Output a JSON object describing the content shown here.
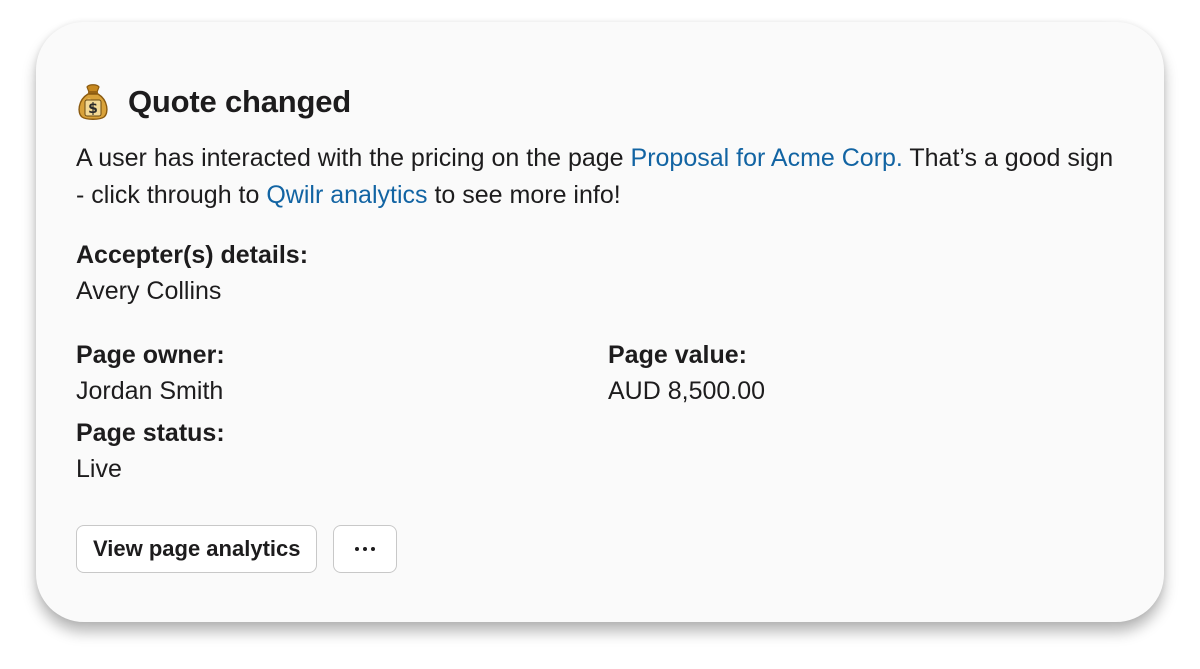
{
  "notification": {
    "icon": "money-bag-icon",
    "title": "Quote changed",
    "message": {
      "text_before": "A user has interacted with the pricing on the page ",
      "page_link": "Proposal for Acme Corp.",
      "text_middle": " That’s a good sign - click through to ",
      "analytics_link": "Qwilr analytics",
      "text_after": " to see more info!"
    },
    "accepter": {
      "label": "Accepter(s) details:",
      "value": "Avery Collins"
    },
    "page_owner": {
      "label": "Page owner:",
      "value": "Jordan Smith"
    },
    "page_value": {
      "label": "Page value:",
      "value": "AUD 8,500.00"
    },
    "page_status": {
      "label": "Page status:",
      "value": "Live"
    },
    "actions": {
      "view_analytics_label": "View page analytics",
      "more_icon": "ellipsis-icon"
    },
    "colors": {
      "link": "#1264a3",
      "text": "#1d1c1d",
      "card_background": "#fafafa"
    }
  }
}
